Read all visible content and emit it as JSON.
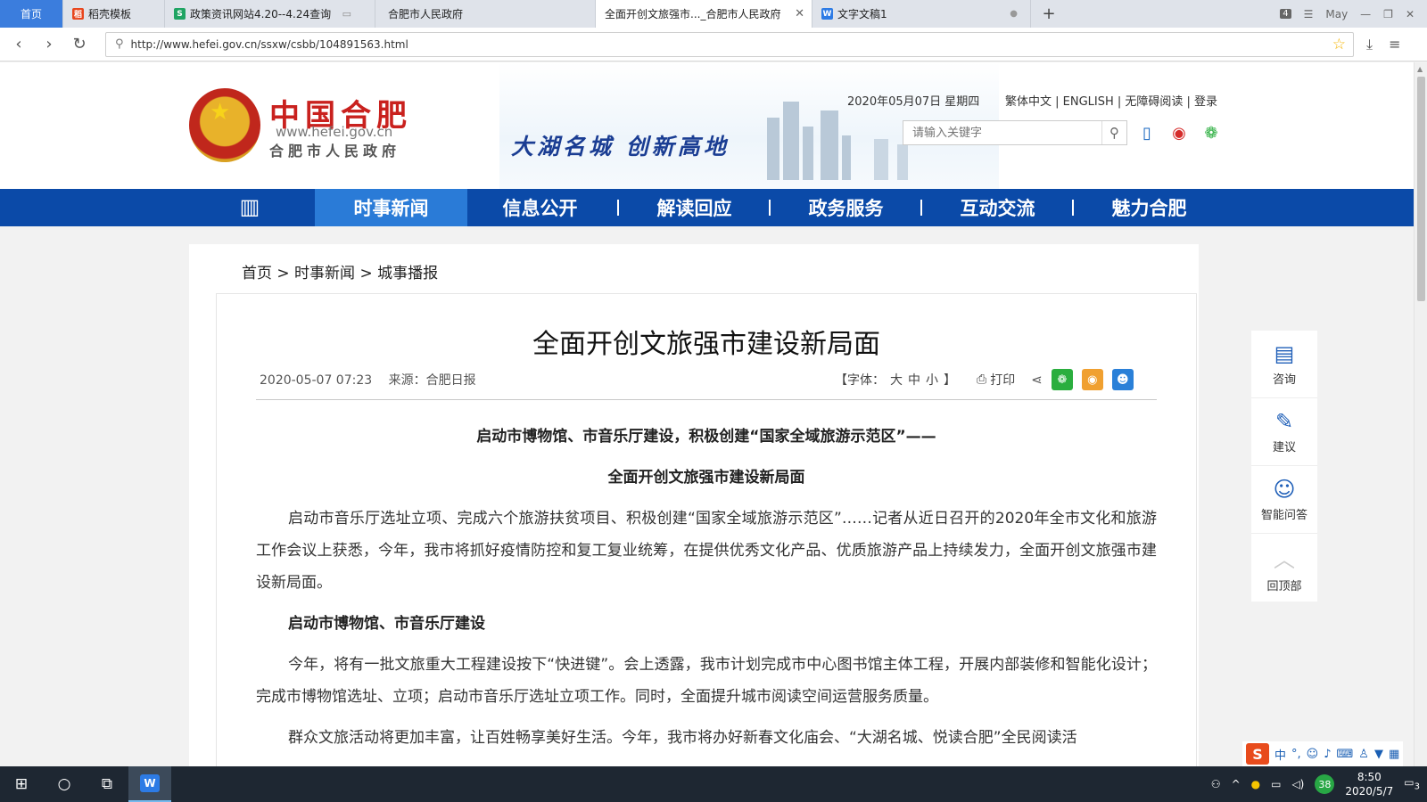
{
  "browser": {
    "tabs": [
      {
        "label": "首页",
        "icon": ""
      },
      {
        "label": "稻壳模板",
        "icon": "docer-icon"
      },
      {
        "label": "政策资讯网站4.20--4.24查询",
        "icon": "spreadsheet-icon"
      },
      {
        "label": "合肥市人民政府",
        "icon": ""
      },
      {
        "label": "全面开创文旅强市..._合肥市人民政府",
        "icon": ""
      },
      {
        "label": "文字文稿1",
        "icon": "word-icon"
      }
    ],
    "tab_count": "4",
    "user_label": "May",
    "url": "http://www.hefei.gov.cn/ssxw/csbb/104891563.html"
  },
  "site_header": {
    "logo_cn": "中国合肥",
    "logo_url": "www.hefei.gov.cn",
    "logo_name": "合肥市人民政府",
    "slogan": "大湖名城  创新高地",
    "date": "2020年05月07日 星期四",
    "links": "繁体中文 | ENGLISH | 无障碍阅读 | 登录",
    "search_placeholder": "请输入关键字"
  },
  "main_nav": {
    "items": [
      "时事新闻",
      "信息公开",
      "解读回应",
      "政务服务",
      "互动交流",
      "魅力合肥"
    ],
    "active_index": 0
  },
  "breadcrumb": "首页 > 时事新闻 > 城事播报",
  "article": {
    "title": "全面开创文旅强市建设新局面",
    "datetime": "2020-05-07 07:23",
    "source": "来源：合肥日报",
    "font_control": [
      "【字体：",
      "大",
      "中",
      "小",
      "】"
    ],
    "print_label": "打印",
    "subheads": [
      "启动市博物馆、市音乐厅建设，积极创建“国家全域旅游示范区”——",
      "全面开创文旅强市建设新局面"
    ],
    "paragraphs": [
      "启动市音乐厅选址立项、完成六个旅游扶贫项目、积极创建“国家全域旅游示范区”……记者从近日召开的2020年全市文化和旅游工作会议上获悉，今年，我市将抓好疫情防控和复工复业统筹，在提供优秀文化产品、优质旅游产品上持续发力，全面开创文旅强市建设新局面。",
      "今年，将有一批文旅重大工程建设按下“快进键”。会上透露，我市计划完成市中心图书馆主体工程，开展内部装修和智能化设计；完成市博物馆选址、立项；启动市音乐厅选址立项工作。同时，全面提升城市阅读空间运营服务质量。",
      "群众文旅活动将更加丰富，让百姓畅享美好生活。今年，我市将办好新春文化庙会、“大湖名城、悦读合肥”全民阅读活"
    ],
    "section_head": "启动市博物馆、市音乐厅建设"
  },
  "side_tools": [
    "咨询",
    "建议",
    "智能问答",
    "回顶部"
  ],
  "ime": {
    "lang": "中"
  },
  "taskbar": {
    "time": "8:50",
    "date": "2020/5/7",
    "badge": "38",
    "notifications": "3"
  }
}
